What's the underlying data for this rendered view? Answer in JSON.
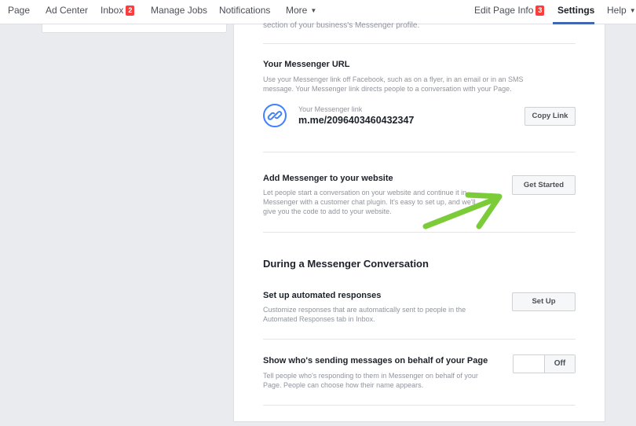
{
  "nav": {
    "page": "Page",
    "ad_center": "Ad Center",
    "inbox": "Inbox",
    "inbox_badge": "2",
    "manage_jobs": "Manage Jobs",
    "notifications": "Notifications",
    "more": "More",
    "edit_page_info": "Edit Page Info",
    "edit_badge": "3",
    "settings": "Settings",
    "help": "Help",
    "accent_color": "#4267b2"
  },
  "main": {
    "cut_text": "section of your business's Messenger profile.",
    "messenger_url": {
      "title": "Your Messenger URL",
      "desc_line1": "Use your Messenger link off Facebook, such as on a flyer, in an email or in an SMS",
      "desc_line2": "message. Your Messenger link directs people to a conversation with your Page.",
      "link_label": "Your Messenger link",
      "link_value": "m.me/2096403460432347",
      "copy_button": "Copy Link",
      "icon": "link-icon"
    },
    "add_website": {
      "title": "Add Messenger to your website",
      "desc_line1": "Let people start a conversation on your website and continue it in",
      "desc_line2": "Messenger with a customer chat plugin. It's easy to set up, and we'll",
      "desc_line3": "give you the code to add to your website.",
      "button": "Get Started"
    },
    "conversation": {
      "heading": "During a Messenger Conversation"
    },
    "automated": {
      "title": "Set up automated responses",
      "desc_line1": "Customize responses that are automatically sent to people in the",
      "desc_line2": "Automated Responses tab in Inbox.",
      "button": "Set Up"
    },
    "behalf": {
      "title": "Show who's sending messages on behalf of your Page",
      "desc_line1": "Tell people who's responding to them in Messenger on behalf of your",
      "desc_line2": "Page. People can choose how their name appears.",
      "toggle_state": "Off"
    }
  },
  "annotation": {
    "arrow_color": "#7ccc3a"
  }
}
